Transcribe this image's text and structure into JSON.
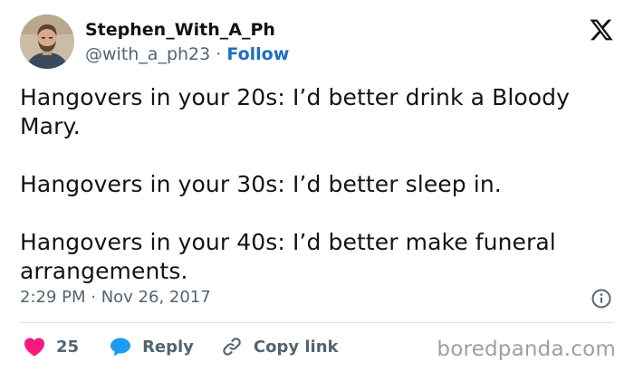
{
  "author": {
    "display_name": "Stephen_With_A_Ph",
    "handle": "@with_a_ph23",
    "separator": "·",
    "follow_label": "Follow"
  },
  "platform": {
    "logo_icon": "x-logo-icon"
  },
  "tweet": {
    "text": "Hangovers in your 20s: I’d better drink a Bloody Mary.\n\nHangovers in your 30s: I’d better sleep in.\n\nHangovers in your 40s: I’d better make funeral arrangements.",
    "timestamp": "2:29 PM · Nov 26, 2017"
  },
  "actions": {
    "like_count": "25",
    "reply_label": "Reply",
    "copy_link_label": "Copy link"
  },
  "watermark": {
    "text": "boredpanda.com"
  },
  "colors": {
    "like": "#f91880",
    "reply": "#1d9bf0",
    "link_accent": "#1d6fc7",
    "secondary_text": "#536471",
    "watermark": "#9aa0a6"
  }
}
